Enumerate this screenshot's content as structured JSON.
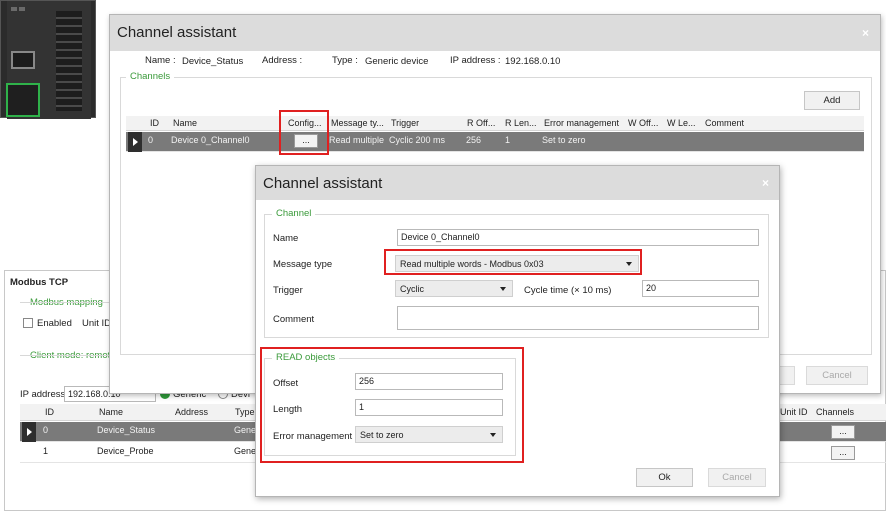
{
  "modbus_panel": {
    "title": "Modbus TCP",
    "mapping_group": "Modbus mapping",
    "enabled_label": "Enabled",
    "unit_id_label": "Unit ID",
    "client_group": "Client mode: remote",
    "ip_label": "IP address",
    "ip_value": "192.168.0.10",
    "radio_generic": "Generic",
    "radio_device": "Devi",
    "columns": [
      "ID",
      "Name",
      "Address",
      "Type",
      "Unit ID",
      "Channels"
    ],
    "rows": [
      {
        "id": "0",
        "name": "Device_Status",
        "type": "Gene",
        "channels_button": "..."
      },
      {
        "id": "1",
        "name": "Device_Probe",
        "type": "Gene",
        "channels_button": "..."
      }
    ]
  },
  "dialog1": {
    "title": "Channel assistant",
    "name_label": "Name :",
    "name_value": "Device_Status",
    "address_label": "Address :",
    "type_label": "Type :",
    "type_value": "Generic device",
    "ip_label": "IP address :",
    "ip_value": "192.168.0.10",
    "channels_group": "Channels",
    "add_button": "Add",
    "columns": [
      "ID",
      "Name",
      "Config...",
      "Message ty...",
      "Trigger",
      "R Off...",
      "R Len...",
      "Error management",
      "W Off...",
      "W Le...",
      "Comment"
    ],
    "row": {
      "id": "0",
      "name": "Device 0_Channel0",
      "config_button": "...",
      "message_type": "Read multiple",
      "trigger": "Cyclic 200 ms",
      "r_offset": "256",
      "r_length": "1",
      "error_management": "Set to zero"
    },
    "cancel_button": "Cancel"
  },
  "dialog2": {
    "title": "Channel assistant",
    "channel_group": "Channel",
    "name_label": "Name",
    "name_value": "Device 0_Channel0",
    "message_type_label": "Message type",
    "message_type_value": "Read multiple words - Modbus 0x03",
    "trigger_label": "Trigger",
    "trigger_value": "Cyclic",
    "cycle_label": "Cycle time (× 10 ms)",
    "cycle_value": "20",
    "comment_label": "Comment",
    "comment_value": "",
    "read_group": "READ objects",
    "offset_label": "Offset",
    "offset_value": "256",
    "length_label": "Length",
    "length_value": "1",
    "error_label": "Error management",
    "error_value": "Set to zero",
    "ok_button": "Ok",
    "cancel_button": "Cancel"
  },
  "colors": {
    "accent_green": "#3a9a3a",
    "highlight_red": "#e02020",
    "selected_row": "#7a7a7a"
  },
  "icons": [
    "close-icon",
    "dropdown-caret-icon",
    "row-pointer-icon"
  ]
}
